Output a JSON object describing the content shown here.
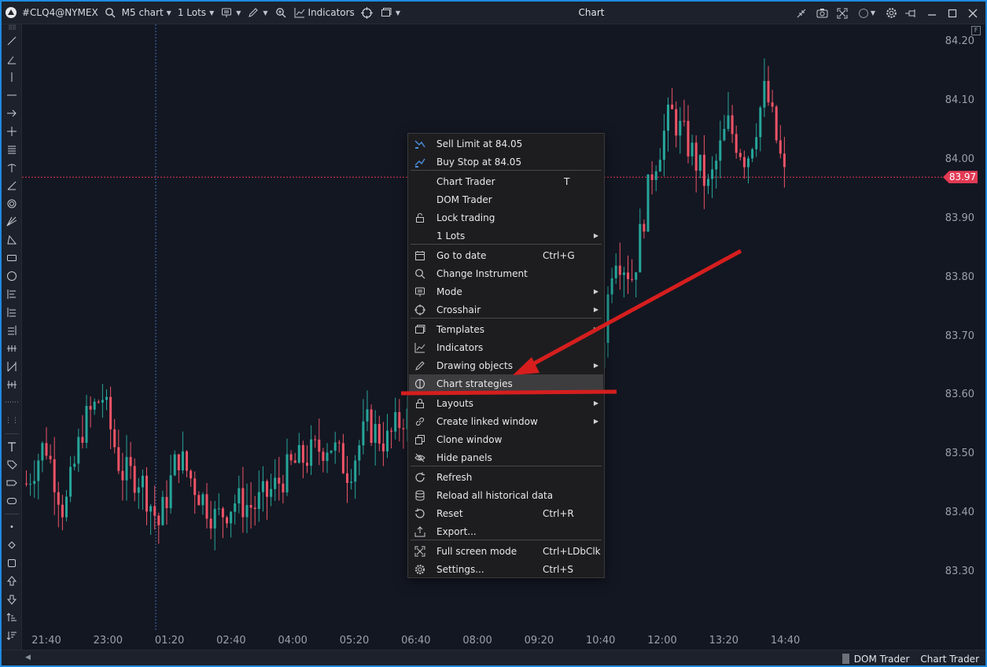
{
  "topbar": {
    "symbol": "#CLQ4@NYMEX",
    "timeframe": "M5 chart",
    "lots": "1 Lots",
    "indicators": "Indicators",
    "title": "Chart"
  },
  "axis": {
    "y_ticks": [
      "84.20",
      "84.10",
      "84.00",
      "83.90",
      "83.80",
      "83.70",
      "83.60",
      "83.50",
      "83.40",
      "83.30"
    ],
    "x_ticks": [
      "21:40",
      "23:00",
      "01:20",
      "02:40",
      "04:00",
      "05:20",
      "06:40",
      "08:00",
      "09:20",
      "10:40",
      "12:00",
      "13:20",
      "14:40"
    ],
    "current_price": "83.97",
    "f_badge": "F"
  },
  "chart_data": {
    "type": "candlestick",
    "symbol": "#CLQ4@NYMEX",
    "timeframe": "M5",
    "ylim": [
      83.22,
      84.24
    ],
    "x_ticks": [
      "21:40",
      "23:00",
      "01:20",
      "02:40",
      "04:00",
      "05:20",
      "06:40",
      "08:00",
      "09:20",
      "10:40",
      "12:00",
      "13:20",
      "14:40"
    ],
    "last_price": 83.97,
    "up_color": "#26a69a",
    "down_color": "#ef5366",
    "close_path": [
      83.45,
      83.52,
      83.4,
      83.55,
      83.6,
      83.47,
      83.46,
      83.38,
      83.5,
      83.44,
      83.39,
      83.42,
      83.41,
      83.44,
      83.48,
      83.5,
      83.52,
      83.47,
      83.55,
      83.52,
      83.57,
      83.5,
      83.52,
      83.49,
      83.52,
      83.46,
      83.49,
      83.52,
      83.62,
      83.66,
      83.58,
      83.85,
      83.8,
      83.98,
      84.08,
      84.02,
      83.95,
      84.06,
      84.0,
      84.12,
      83.97
    ]
  },
  "context_menu": {
    "items": [
      {
        "icon": "sell-limit-icon",
        "label": "Sell Limit at 84.05",
        "shortcut": "",
        "submenu": false
      },
      {
        "icon": "buy-stop-icon",
        "label": "Buy Stop at 84.05",
        "shortcut": "",
        "submenu": false
      },
      {
        "icon": "",
        "label": "Chart Trader",
        "shortcut": "T",
        "submenu": false
      },
      {
        "icon": "",
        "label": "DOM Trader",
        "shortcut": "",
        "submenu": false
      },
      {
        "icon": "lock-icon",
        "label": "Lock trading",
        "shortcut": "",
        "submenu": false
      },
      {
        "icon": "",
        "label": "1 Lots",
        "shortcut": "",
        "submenu": true
      },
      {
        "icon": "calendar-icon",
        "label": "Go to date",
        "shortcut": "Ctrl+G",
        "submenu": false
      },
      {
        "icon": "search-icon",
        "label": "Change Instrument",
        "shortcut": "",
        "submenu": false
      },
      {
        "icon": "mode-icon",
        "label": "Mode",
        "shortcut": "",
        "submenu": true
      },
      {
        "icon": "crosshair-icon",
        "label": "Crosshair",
        "shortcut": "",
        "submenu": true
      },
      {
        "icon": "templates-icon",
        "label": "Templates",
        "shortcut": "",
        "submenu": true
      },
      {
        "icon": "indicators-icon",
        "label": "Indicators",
        "shortcut": "",
        "submenu": false
      },
      {
        "icon": "pencil-icon",
        "label": "Drawing objects",
        "shortcut": "",
        "submenu": true
      },
      {
        "icon": "strategy-icon",
        "label": "Chart strategies",
        "shortcut": "",
        "submenu": false
      },
      {
        "icon": "layouts-icon",
        "label": "Layouts",
        "shortcut": "",
        "submenu": true
      },
      {
        "icon": "link-icon",
        "label": "Create linked window",
        "shortcut": "",
        "submenu": true
      },
      {
        "icon": "clone-icon",
        "label": "Clone window",
        "shortcut": "",
        "submenu": false
      },
      {
        "icon": "hide-panels-icon",
        "label": "Hide panels",
        "shortcut": "",
        "submenu": false
      },
      {
        "icon": "refresh-icon",
        "label": "Refresh",
        "shortcut": "",
        "submenu": false
      },
      {
        "icon": "database-icon",
        "label": "Reload all historical data",
        "shortcut": "",
        "submenu": false
      },
      {
        "icon": "reset-icon",
        "label": "Reset",
        "shortcut": "Ctrl+R",
        "submenu": false
      },
      {
        "icon": "export-icon",
        "label": "Export...",
        "shortcut": "",
        "submenu": false
      },
      {
        "icon": "fullscreen-icon",
        "label": "Full screen mode",
        "shortcut": "Ctrl+LDbClk",
        "submenu": false
      },
      {
        "icon": "settings-icon",
        "label": "Settings...",
        "shortcut": "Ctrl+S",
        "submenu": false
      }
    ],
    "highlighted": "Chart strategies"
  },
  "bottombar": {
    "tabs": [
      "DOM Trader",
      "Chart Trader"
    ]
  },
  "colors": {
    "background": "#131722",
    "up": "#26a69a",
    "down": "#ef5366",
    "price_line": "#e23a54",
    "annotation_arrow": "#d61e1e",
    "window_border": "#1f8ae0"
  }
}
